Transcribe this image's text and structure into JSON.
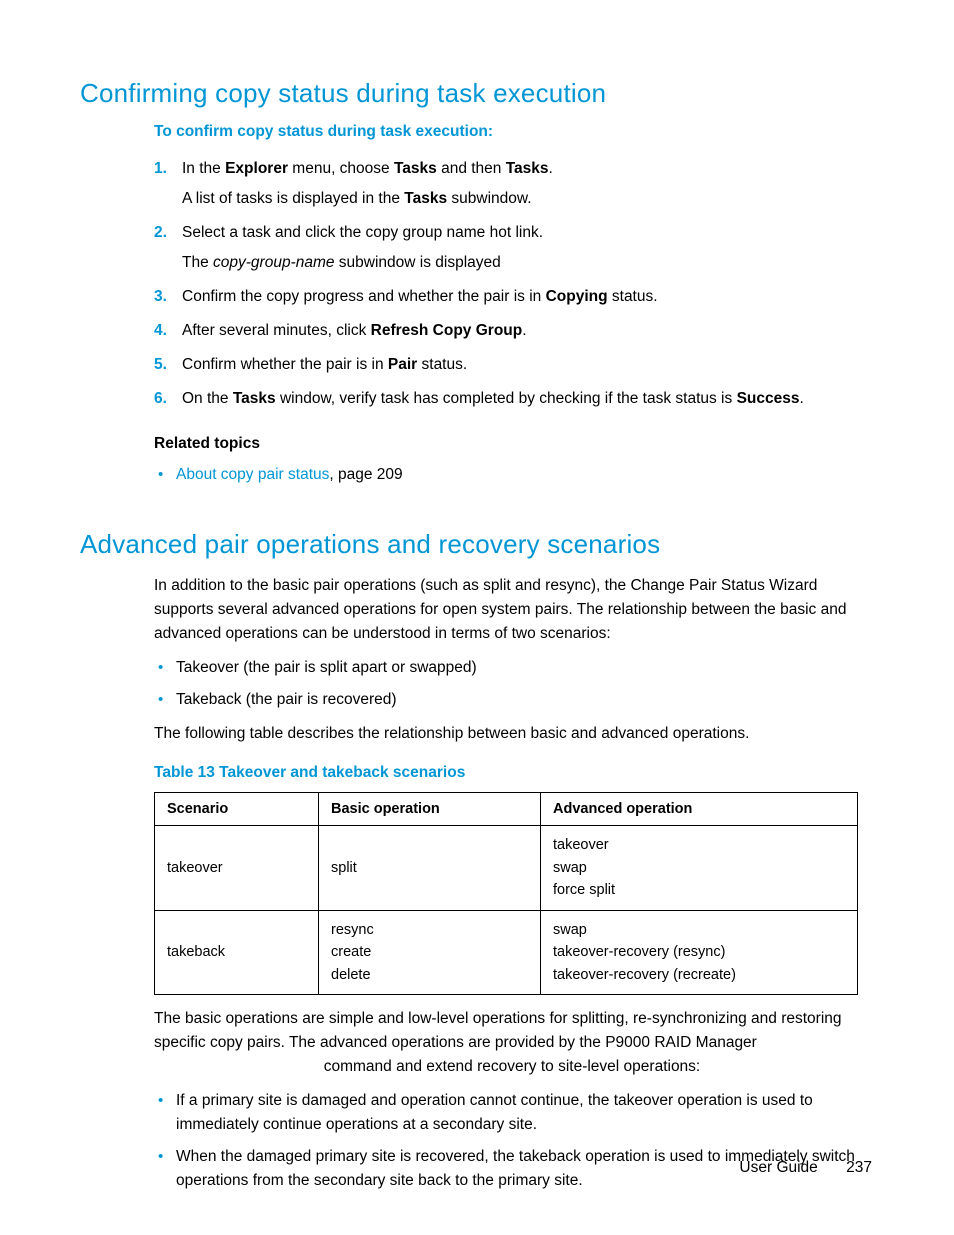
{
  "section1": {
    "heading": "Confirming copy status during task execution",
    "intro": "To confirm copy status during task execution:",
    "steps": [
      {
        "pre1": "In the ",
        "b1": "Explorer",
        "mid1": " menu, choose ",
        "b2": "Tasks",
        "mid2": " and then ",
        "b3": "Tasks",
        "post1": ".",
        "sub_pre": "A list of tasks is displayed in the ",
        "sub_b": "Tasks",
        "sub_post": " subwindow."
      },
      {
        "line": "Select a task and click the copy group name hot link.",
        "sub_pre": "The ",
        "sub_i": "copy-group-name",
        "sub_post": " subwindow is displayed"
      },
      {
        "pre": "Confirm the copy progress and whether the pair is in ",
        "b": "Copying",
        "post": " status."
      },
      {
        "pre": "After several minutes, click ",
        "b": "Refresh Copy Group",
        "post": "."
      },
      {
        "pre": "Confirm whether the pair is in ",
        "b": "Pair",
        "post": " status."
      },
      {
        "pre": "On the ",
        "b1": "Tasks",
        "mid": " window, verify task has completed by checking if the task status is ",
        "b2": "Success",
        "post": "."
      }
    ],
    "related_heading": "Related topics",
    "related_link": "About copy pair status",
    "related_tail": ", page 209"
  },
  "section2": {
    "heading": "Advanced pair operations and recovery scenarios",
    "para1": "In addition to the basic pair operations (such as split and resync), the Change Pair Status Wizard supports several advanced operations for open system pairs. The relationship between the basic and advanced operations can be understood in terms of two scenarios:",
    "bullets1": [
      "Takeover (the pair is split apart or swapped)",
      "Takeback (the pair is recovered)"
    ],
    "para2": "The following table describes the relationship between basic and advanced operations.",
    "table_caption": "Table 13 Takeover and takeback scenarios",
    "table": {
      "headers": [
        "Scenario",
        "Basic operation",
        "Advanced operation"
      ],
      "rows": [
        {
          "scenario": "takeover",
          "basic": "split",
          "adv": [
            "takeover",
            "swap",
            "force split"
          ]
        },
        {
          "scenario": "takeback",
          "basic_lines": [
            "resync",
            "create",
            "delete"
          ],
          "adv": [
            "swap",
            "takeover-recovery (resync)",
            "takeover-recovery (recreate)"
          ]
        }
      ]
    },
    "para3a": "The basic operations are simple and low-level operations for splitting, re-synchronizing and restoring specific copy pairs. The advanced operations are provided by the P9000 RAID Manager",
    "para3b": "command and extend recovery to site-level operations:",
    "bullets2": [
      "If a primary site is damaged and operation cannot continue, the takeover operation is used to immediately continue operations at a secondary site.",
      "When the damaged primary site is recovered, the takeback operation is used to immediately switch operations from the secondary site back to the primary site."
    ]
  },
  "footer": {
    "label": "User Guide",
    "page": "237"
  }
}
